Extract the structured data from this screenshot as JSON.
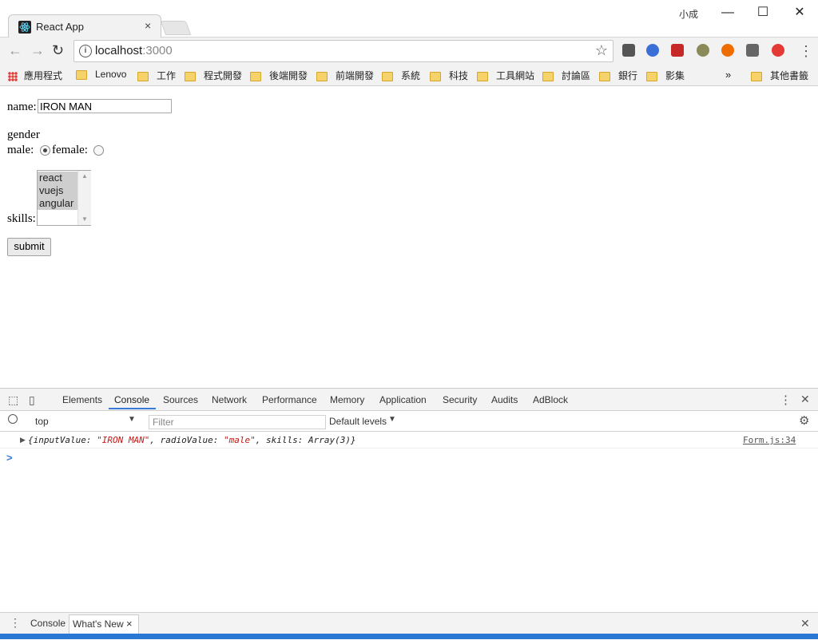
{
  "browser": {
    "tab_title": "React App",
    "tab_close": "×",
    "user_name": "小成",
    "window_controls": {
      "minimize": "—",
      "maximize": "☐",
      "close": "✕"
    },
    "url_host": "localhost",
    "url_port": ":3000",
    "bookmarks_overflow": "»",
    "bookmarks": [
      "應用程式",
      "Lenovo",
      "工作",
      "程式開發",
      "後端開發",
      "前端開發",
      "系統",
      "科技",
      "工具網站",
      "討論區",
      "銀行",
      "影集"
    ],
    "other_bookmarks": "其他書籤"
  },
  "form": {
    "name_label": "name:",
    "name_value": "IRON MAN",
    "gender_label": "gender",
    "male_label": "male:",
    "female_label": "female:",
    "gender_selected": "male",
    "skills_label": "skills:",
    "skills_options": [
      "react",
      "vuejs",
      "angular"
    ],
    "submit_label": "submit"
  },
  "devtools": {
    "tabs": [
      "Elements",
      "Console",
      "Sources",
      "Network",
      "Performance",
      "Memory",
      "Application",
      "Security",
      "Audits",
      "AdBlock"
    ],
    "active_tab": "Console",
    "context": "top",
    "filter_placeholder": "Filter",
    "levels": "Default levels",
    "log": {
      "open": "{inputValue: ",
      "v1": "\"IRON MAN\"",
      "mid1": ", radioValue: ",
      "v2": "\"male\"",
      "mid2": ", skills: Array(3)}",
      "source": "Form.js:34"
    },
    "prompt": ">",
    "drawer_tabs": [
      "Console",
      "What's New"
    ],
    "drawer_close": "×"
  },
  "colors": {
    "accent": "#3879d9",
    "string_red": "#c41a16",
    "source_link": "#555555"
  }
}
